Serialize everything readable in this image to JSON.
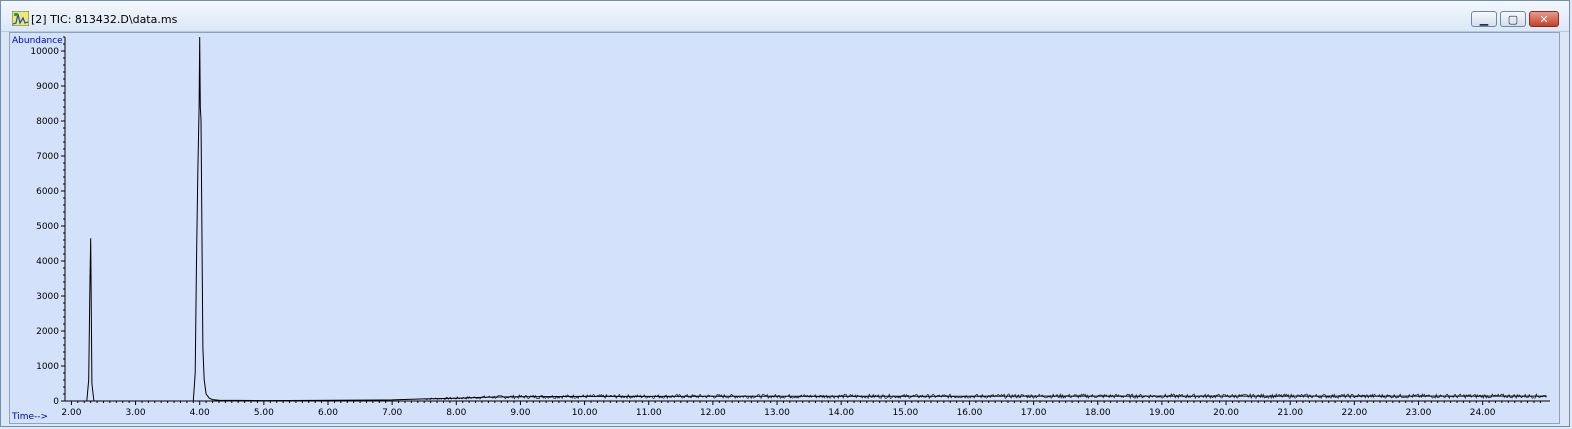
{
  "window": {
    "title": "[2] TIC: 813432.D\\data.ms",
    "icon": "chromatogram-app-icon",
    "controls": {
      "minimize": "minimize-icon",
      "restore": "restore-icon",
      "close": "close-icon"
    }
  },
  "chart_data": {
    "type": "line",
    "ylabel": "Abundance",
    "xlabel": "Time-->",
    "xlim": [
      1.9,
      25.05
    ],
    "ylim": [
      0,
      10400
    ],
    "xticks": [
      "2.00",
      "3.00",
      "4.00",
      "5.00",
      "6.00",
      "7.00",
      "8.00",
      "9.00",
      "10.00",
      "11.00",
      "12.00",
      "13.00",
      "14.00",
      "15.00",
      "16.00",
      "17.00",
      "18.00",
      "19.00",
      "20.00",
      "21.00",
      "22.00",
      "23.00",
      "24.00"
    ],
    "yticks": [
      "0",
      "1000",
      "2000",
      "3000",
      "4000",
      "5000",
      "6000",
      "7000",
      "8000",
      "9000",
      "10000"
    ],
    "grid": false,
    "series": [
      {
        "color": "#000000",
        "x": [
          1.9,
          2.1,
          2.24,
          2.27,
          2.29,
          2.3,
          2.31,
          2.32,
          2.35,
          2.5,
          3.5,
          3.9,
          3.93,
          3.95,
          3.97,
          3.99,
          4.0,
          4.01,
          4.02,
          4.03,
          4.04,
          4.05,
          4.07,
          4.1,
          4.15,
          4.2,
          4.3,
          5.0,
          7.0,
          7.5,
          8.0,
          8.5,
          9.0,
          10.0,
          11.0,
          12.0,
          13.0,
          14.0,
          15.0,
          16.0,
          17.0,
          18.0,
          19.0,
          20.0,
          21.0,
          22.0,
          23.0,
          24.0,
          25.0
        ],
        "y": [
          0,
          0,
          0,
          600,
          3500,
          4650,
          2600,
          500,
          0,
          0,
          0,
          0,
          800,
          4000,
          6500,
          8400,
          10400,
          8400,
          8050,
          6000,
          3500,
          1500,
          600,
          200,
          80,
          40,
          20,
          10,
          30,
          60,
          80,
          110,
          120,
          130,
          130,
          135,
          135,
          135,
          135,
          135,
          140,
          140,
          140,
          140,
          140,
          140,
          140,
          140,
          140
        ]
      }
    ]
  }
}
